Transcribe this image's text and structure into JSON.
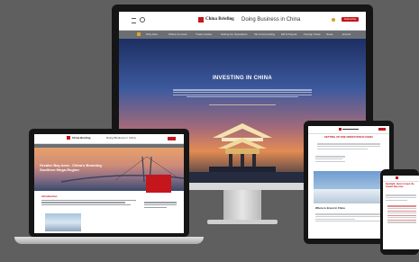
{
  "brand": {
    "name": "China Briefing",
    "tagline": "Doing Business in China",
    "accent": "#c4161c"
  },
  "desktop": {
    "nav_items": [
      "Why Asia",
      "Where & Invest",
      "Trade Guides",
      "Setting Up Operations",
      "Tax & Accounting",
      "HR & Payroll",
      "Foreign Trade",
      "News",
      "Events"
    ],
    "hero_title": "INVESTING IN CHINA",
    "subscribe_label": "Subscribe",
    "hero_body_lines": 4
  },
  "laptop": {
    "headline": "Greater Bay Area - China's Booming Southern Mega-Region",
    "section_label": "Introduction"
  },
  "tablet": {
    "headline": "SETTING UP ONE OPERATION IN CHINA",
    "subhead": "Where to Invest in China"
  },
  "phone": {
    "headline": "Spotlight: How to Invest the Greater Bay Area"
  },
  "icons": {
    "menu": "hamburger-icon",
    "search": "search-icon",
    "user": "user-icon"
  }
}
